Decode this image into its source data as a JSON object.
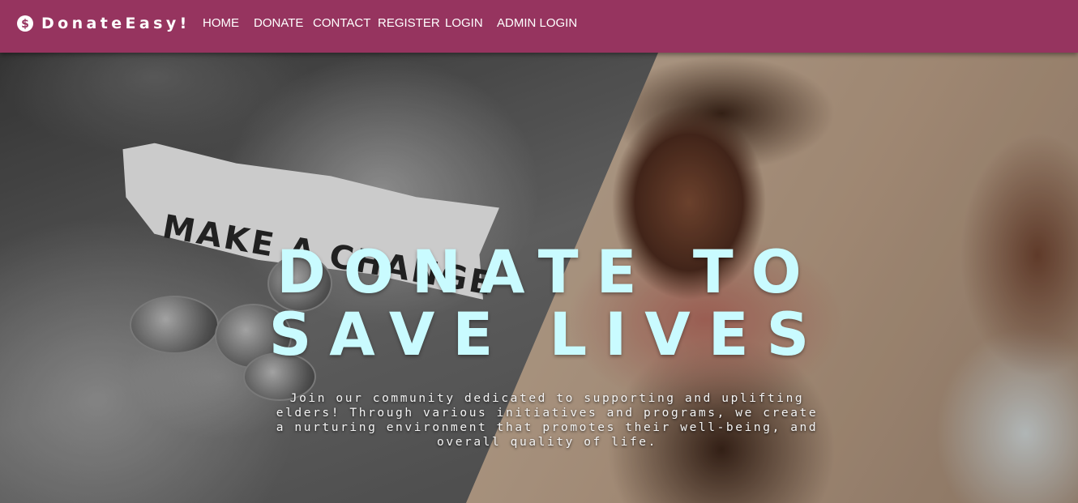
{
  "brand": {
    "name": "DonateEasy!",
    "icon": "dollar-circle-icon"
  },
  "nav": {
    "home": "HOME",
    "donate": "DONATE",
    "contact": "CONTACT",
    "register": "REGISTER",
    "login": "LOGIN",
    "admin_login": "ADMIN LOGIN"
  },
  "hero": {
    "title_line1": "DONATE TO",
    "title_line2": "SAVE LIVES",
    "description": "Join our community dedicated to supporting and uplifting elders! Through various initiatives and programs, we create a nurturing environment that promotes their well-being, and overall quality of life.",
    "photo_note": "MAKE A CHANGE"
  },
  "colors": {
    "navbar": "#96345f",
    "title": "#c9fbff",
    "nav_text": "#ffffff"
  }
}
